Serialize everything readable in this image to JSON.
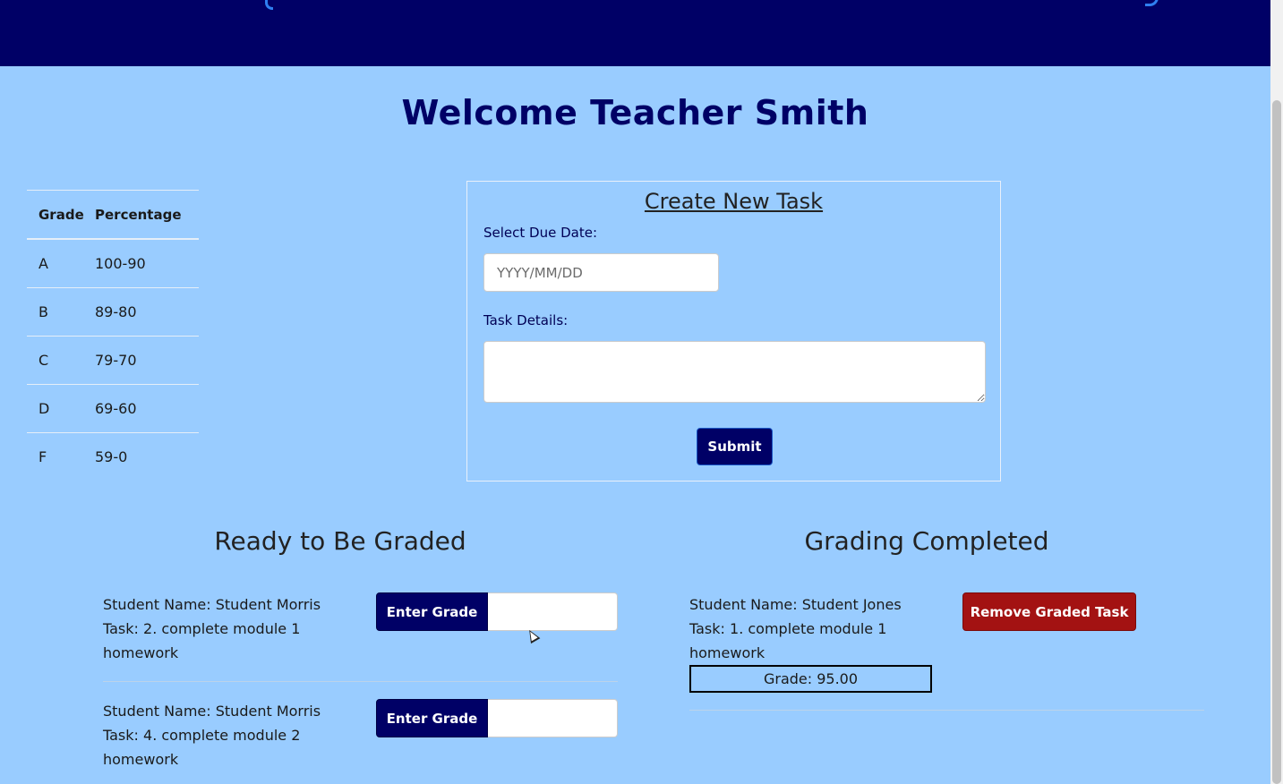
{
  "header": {
    "welcome": "Welcome Teacher Smith"
  },
  "grade_table": {
    "headers": [
      "Grade",
      "Percentage"
    ],
    "rows": [
      {
        "grade": "A",
        "percentage": "100-90"
      },
      {
        "grade": "B",
        "percentage": "89-80"
      },
      {
        "grade": "C",
        "percentage": "79-70"
      },
      {
        "grade": "D",
        "percentage": "69-60"
      },
      {
        "grade": "F",
        "percentage": "59-0"
      }
    ]
  },
  "task_form": {
    "title": "Create New Task",
    "due_label": "Select Due Date:",
    "due_placeholder": "YYYY/MM/DD",
    "details_label": "Task Details:",
    "submit_label": "Submit"
  },
  "ready": {
    "title": "Ready to Be Graded",
    "enter_grade_label": "Enter Grade",
    "items": [
      {
        "student": "Student Name: Student Morris",
        "task": "Task: 2. complete module 1 homework"
      },
      {
        "student": "Student Name: Student Morris",
        "task": "Task: 4. complete module 2 homework"
      }
    ]
  },
  "completed": {
    "title": "Grading Completed",
    "remove_label": "Remove Graded Task",
    "items": [
      {
        "student": "Student Name: Student Jones",
        "task": "Task: 1. complete module 1 homework",
        "grade": "Grade: 95.00"
      }
    ]
  },
  "colors": {
    "navy": "#000066",
    "background": "#99ccff",
    "danger": "#a31212"
  }
}
